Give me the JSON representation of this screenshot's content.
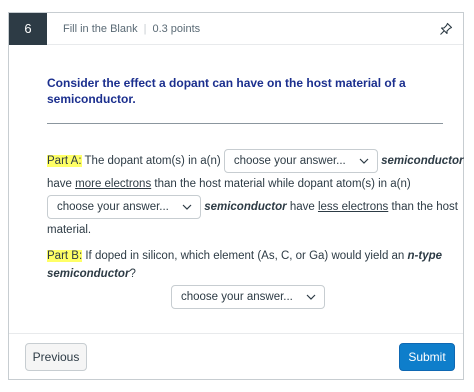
{
  "question": {
    "number": "6",
    "type": "Fill in the Blank",
    "points": "0.3 points",
    "prompt": "Consider the effect a dopant can have on the host material of a semiconductor."
  },
  "part_a": {
    "label": "Part A",
    "colon": ":",
    "text1": " The dopant atom(s) in a(n) ",
    "term1": "semiconductor",
    "text2": "have ",
    "more": "more electrons",
    "text3": " than the host material while dopant atom(s) in a(n)",
    "term2": "semiconductor",
    "text4": " have ",
    "less": "less electrons",
    "text5": " than the host",
    "text6": "material."
  },
  "part_b": {
    "label": "Part B",
    "colon": ":",
    "text1": " If doped in silicon, which element (As, C, or Ga) would yield an ",
    "term": "n-type",
    "term2": "semiconductor",
    "text2": "?"
  },
  "dropdowns": {
    "a1": "choose your answer...",
    "a2": "choose your answer...",
    "b1": "choose your answer..."
  },
  "footer": {
    "previous": "Previous",
    "submit": "Submit"
  },
  "colors": {
    "highlight": "#ffff66",
    "prompt": "#1b2f8e",
    "submit": "#0e7ecb"
  }
}
